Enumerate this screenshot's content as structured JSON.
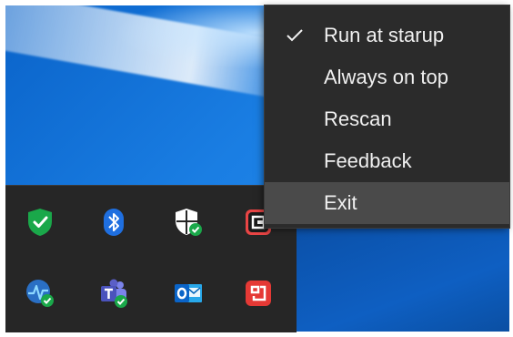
{
  "context_menu": {
    "items": [
      {
        "label": "Run at starup",
        "checked": true,
        "icon": "checkmark-icon"
      },
      {
        "label": "Always on top",
        "checked": false
      },
      {
        "label": "Rescan",
        "checked": false
      },
      {
        "label": "Feedback",
        "checked": false
      },
      {
        "label": "Exit",
        "checked": false,
        "highlighted": true
      }
    ]
  },
  "tray_overflow": {
    "icons": [
      {
        "name": "windows-security-icon"
      },
      {
        "name": "bluetooth-icon"
      },
      {
        "name": "defender-shield-icon"
      },
      {
        "name": "app-tray-icon"
      },
      {
        "name": "network-health-icon"
      },
      {
        "name": "microsoft-teams-icon"
      },
      {
        "name": "outlook-icon"
      },
      {
        "name": "red-app-icon"
      }
    ]
  },
  "colors": {
    "menu_background": "#2b2b2b",
    "menu_highlight": "#4a4a4a",
    "tray_background": "#262626",
    "wallpaper_blue": "#1a7ee3"
  }
}
